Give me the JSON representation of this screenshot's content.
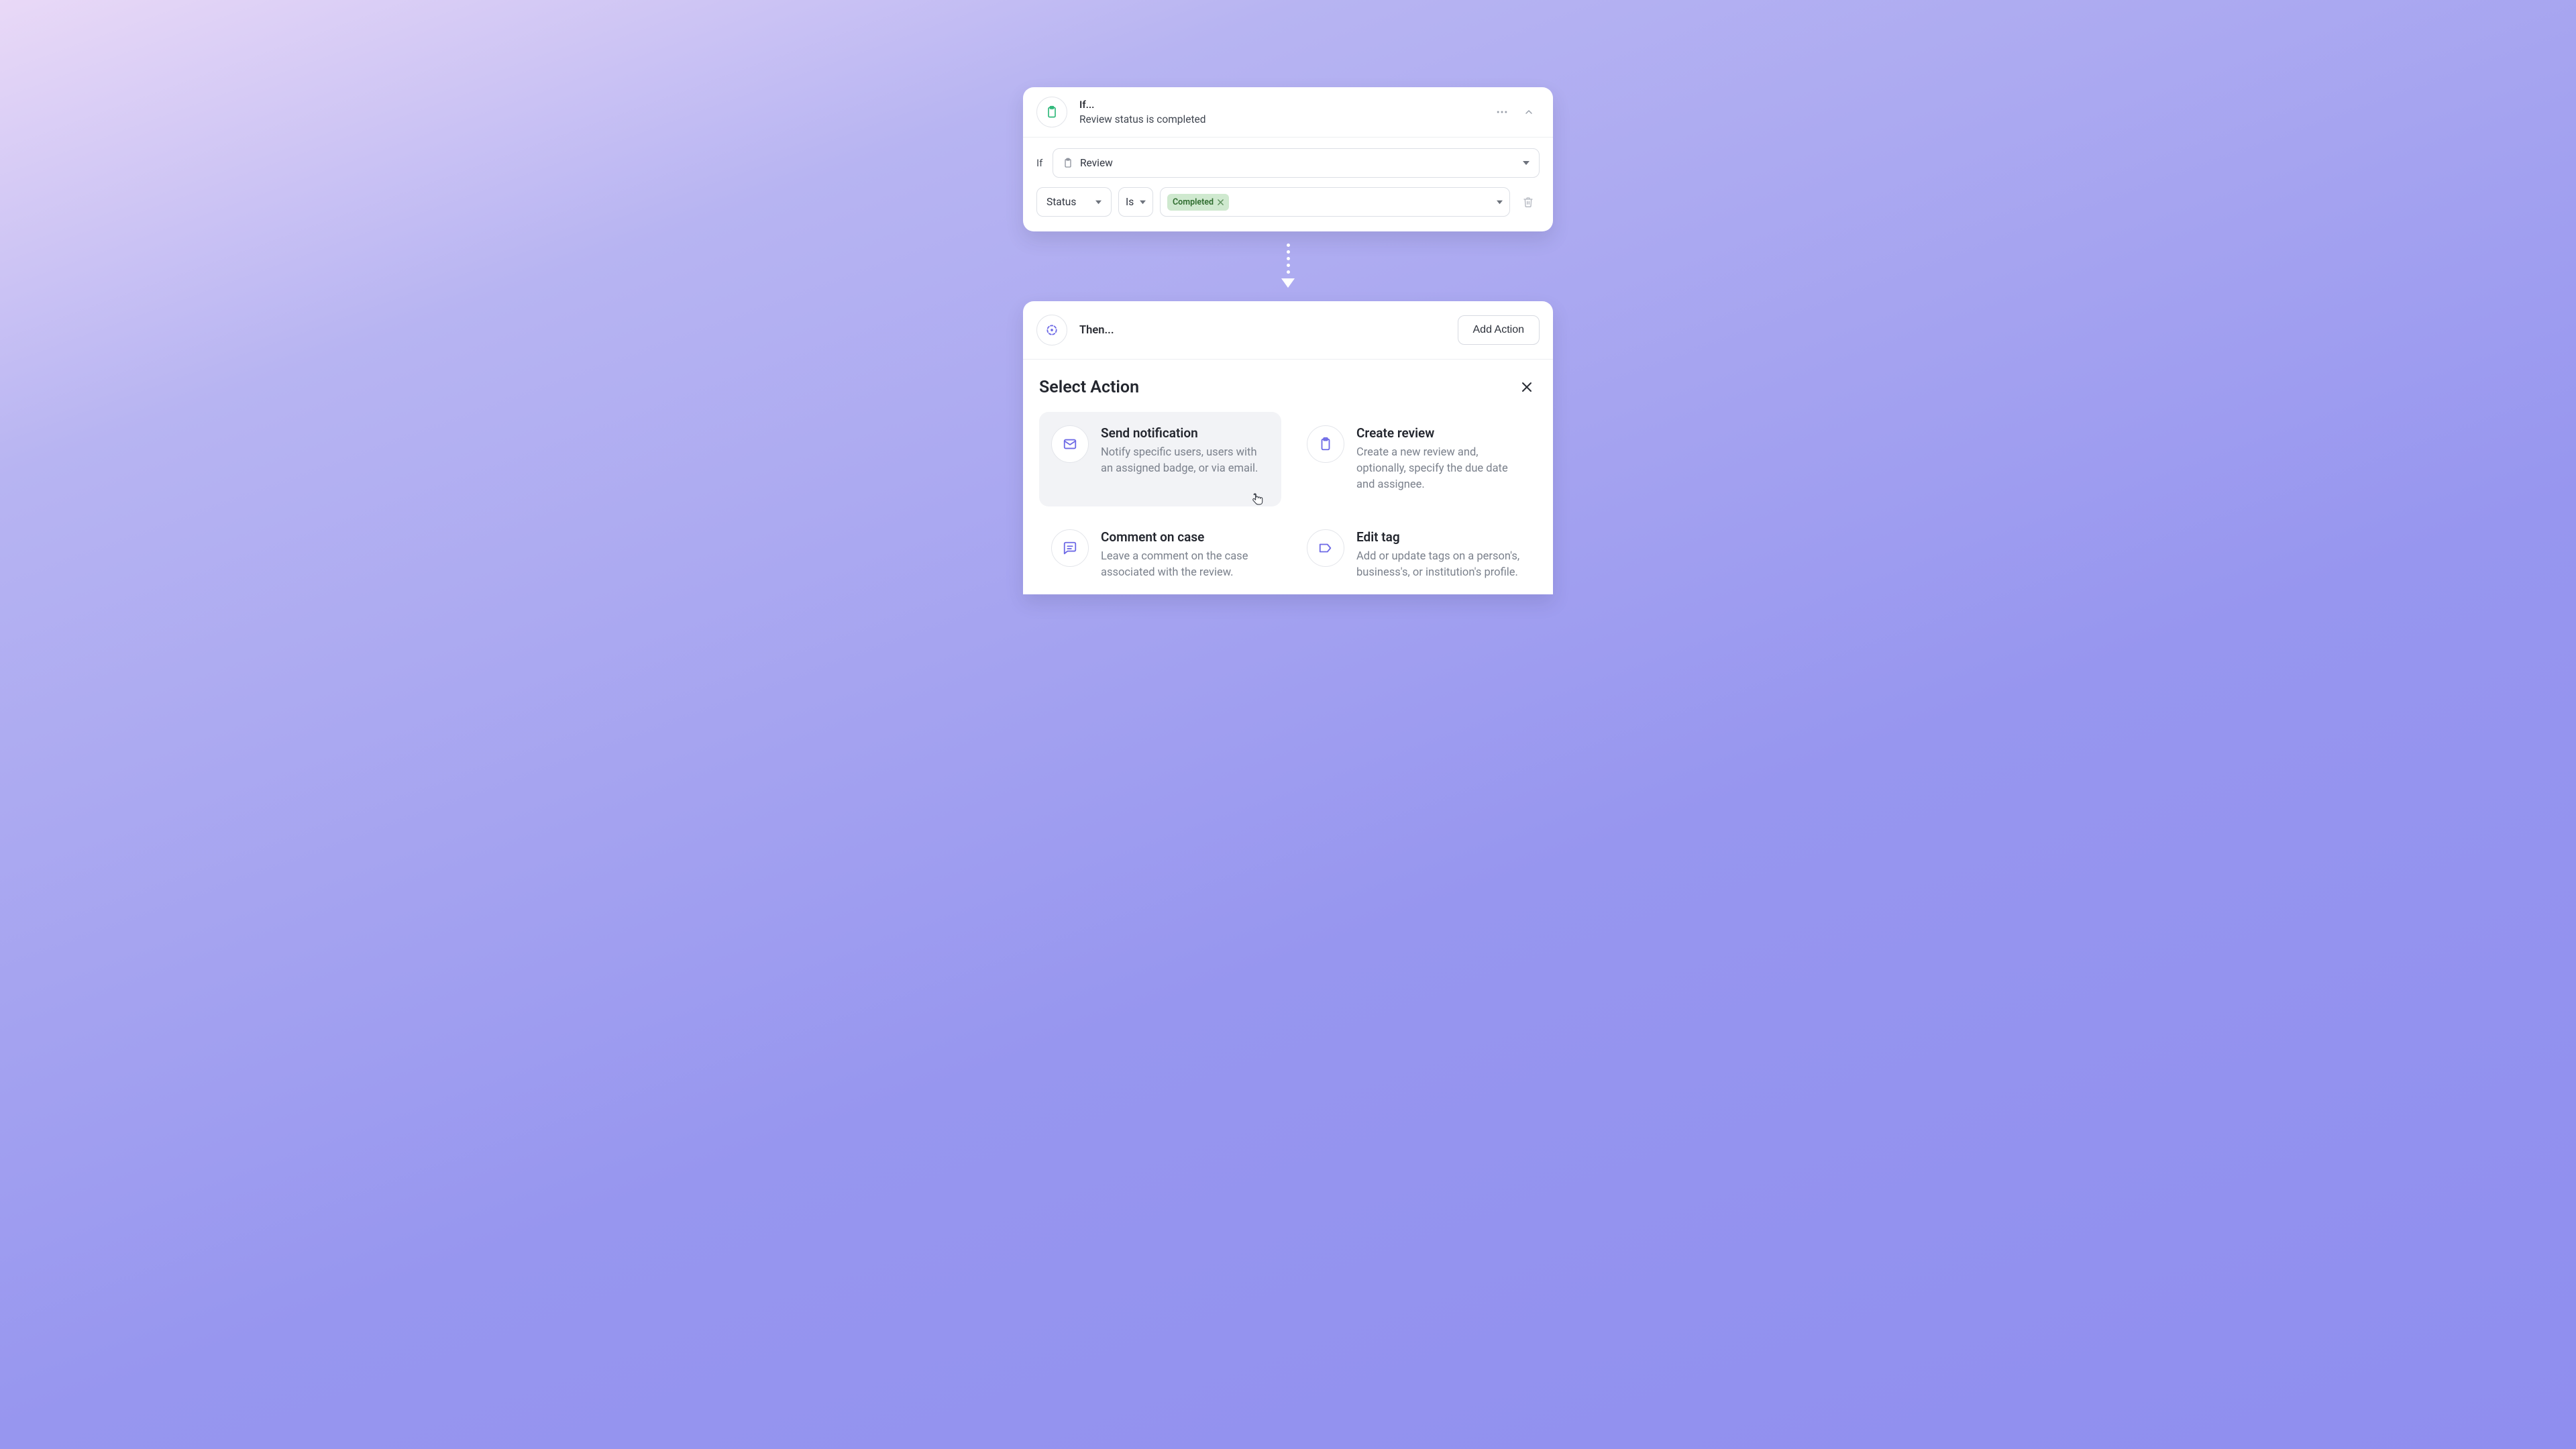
{
  "if": {
    "title": "If...",
    "subtitle": "Review status is completed",
    "prefix": "If",
    "entity": "Review",
    "field": "Status",
    "operator": "Is",
    "value_chip": "Completed"
  },
  "then": {
    "title": "Then...",
    "add_action_label": "Add Action",
    "select_action_title": "Select Action",
    "actions": [
      {
        "title": "Send notification",
        "desc": "Notify specific users, users with an assigned badge, or via email."
      },
      {
        "title": "Create review",
        "desc": "Create a new review and, optionally, specify the due date and assignee."
      },
      {
        "title": "Comment on case",
        "desc": "Leave a comment on the case associated with the review."
      },
      {
        "title": "Edit tag",
        "desc": "Add or update tags on a person's, business's, or institution's profile."
      }
    ]
  },
  "colors": {
    "clipboard_green": "#2fb87a",
    "action_indigo": "#6e6ae6"
  }
}
